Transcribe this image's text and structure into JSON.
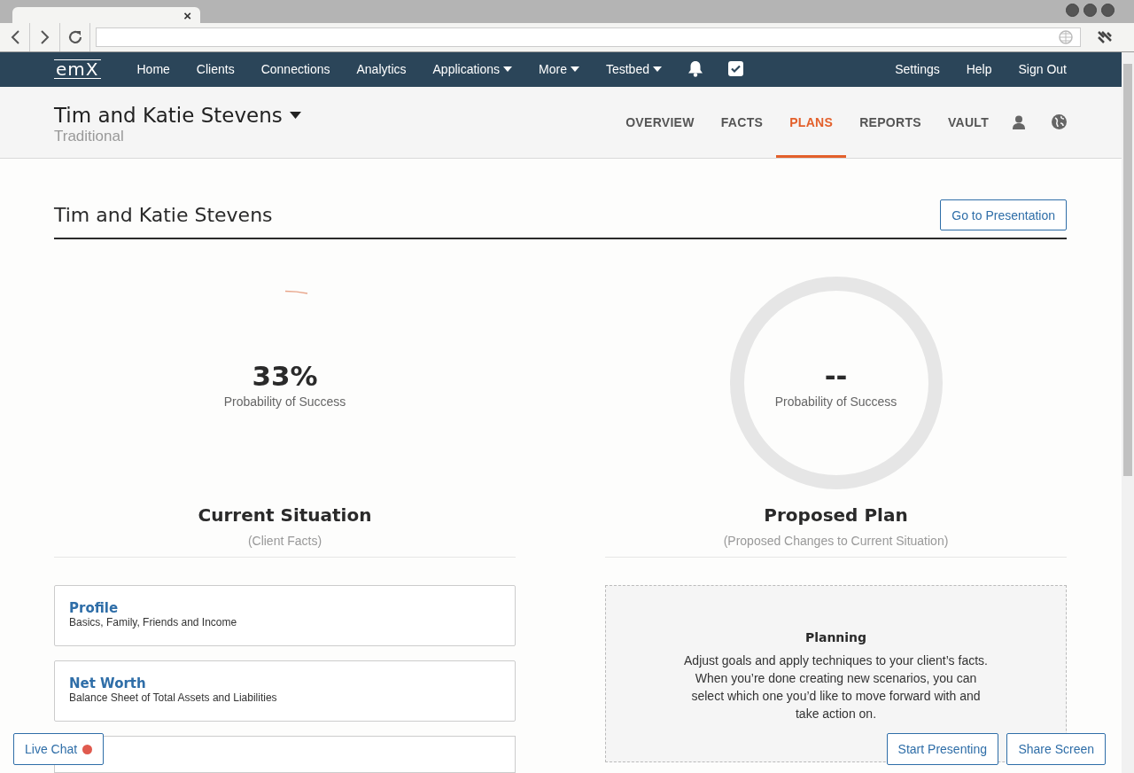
{
  "browser": {
    "tab_close": "×"
  },
  "nav": {
    "logo": "emX",
    "items": [
      {
        "label": "Home",
        "dropdown": false
      },
      {
        "label": "Clients",
        "dropdown": false
      },
      {
        "label": "Connections",
        "dropdown": false
      },
      {
        "label": "Analytics",
        "dropdown": false
      },
      {
        "label": "Applications",
        "dropdown": true
      },
      {
        "label": "More",
        "dropdown": true
      },
      {
        "label": "Testbed",
        "dropdown": true
      }
    ],
    "right_items": [
      "Settings",
      "Help",
      "Sign Out"
    ]
  },
  "client": {
    "name": "Tim and Katie Stevens",
    "plan_type": "Traditional",
    "tabs": [
      {
        "label": "OVERVIEW",
        "selected": false
      },
      {
        "label": "FACTS",
        "selected": false
      },
      {
        "label": "PLANS",
        "selected": true
      },
      {
        "label": "REPORTS",
        "selected": false
      },
      {
        "label": "VAULT",
        "selected": false
      }
    ]
  },
  "page": {
    "title": "Tim and Katie Stevens",
    "presentation_button": "Go to Presentation"
  },
  "current": {
    "value": "33%",
    "label": "Probability of Success",
    "heading": "Current Situation",
    "subheading": "(Client Facts)",
    "cards": [
      {
        "title": "Profile",
        "description": "Basics, Family, Friends and Income"
      },
      {
        "title": "Net Worth",
        "description": "Balance Sheet of Total Assets and Liabilities"
      }
    ]
  },
  "proposed": {
    "value": "--",
    "label": "Probability of Success",
    "heading": "Proposed Plan",
    "subheading": "(Proposed Changes to Current Situation)",
    "planning": {
      "title": "Planning",
      "text": "Adjust goals and apply techniques to your client’s facts. When you’re done creating new scenarios, you can select which one you’d like to move forward with and take action on."
    }
  },
  "overlay": {
    "live_chat": "Live Chat",
    "buttons": [
      "Start Presenting",
      "Share Screen"
    ]
  }
}
